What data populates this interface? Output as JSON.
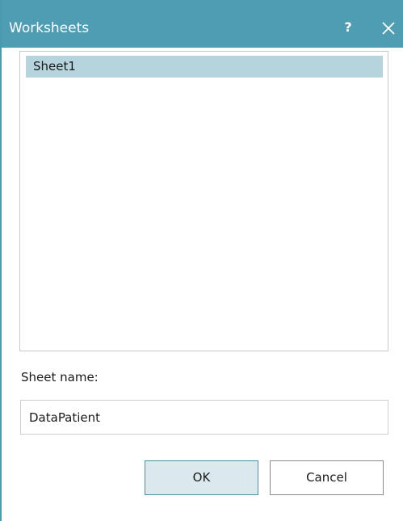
{
  "window": {
    "title": "Worksheets",
    "help_label": "?",
    "close_icon": "close-icon",
    "titlebar_color": "#4e9db3"
  },
  "sheets": {
    "items": [
      {
        "label": "Sheet1",
        "selected": true
      }
    ],
    "selection_color": "#b5d4de"
  },
  "sheet_name": {
    "label": "Sheet name:",
    "value": "DataPatient"
  },
  "buttons": {
    "ok_label": "OK",
    "cancel_label": "Cancel"
  }
}
